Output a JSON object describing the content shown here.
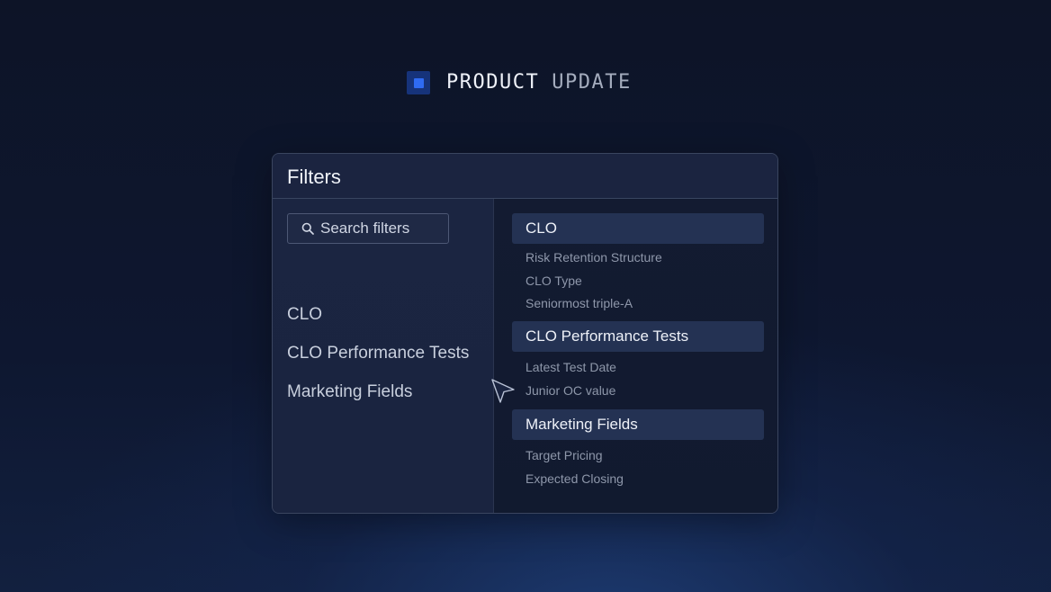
{
  "brand": {
    "word1": "PRODUCT",
    "word2": "UPDATE"
  },
  "filters": {
    "title": "Filters",
    "search": {
      "placeholder": "Search filters"
    },
    "categories": [
      {
        "label": "CLO"
      },
      {
        "label": "CLO Performance Tests"
      },
      {
        "label": "Marketing Fields"
      }
    ],
    "groups": [
      {
        "title": "CLO",
        "items": [
          "Risk Retention Structure",
          "CLO Type",
          "Seniormost triple-A"
        ]
      },
      {
        "title": "CLO Performance Tests",
        "items": [
          "Latest Test Date",
          "Junior OC value"
        ]
      },
      {
        "title": "Marketing Fields",
        "items": [
          "Target Pricing",
          "Expected Closing"
        ]
      }
    ]
  },
  "colors": {
    "accent": "#2f6bf2",
    "background": "#0e1730"
  },
  "icons": {
    "search": "search-icon",
    "cursor": "mouse-pointer-icon",
    "brand": "square-logo-icon"
  }
}
